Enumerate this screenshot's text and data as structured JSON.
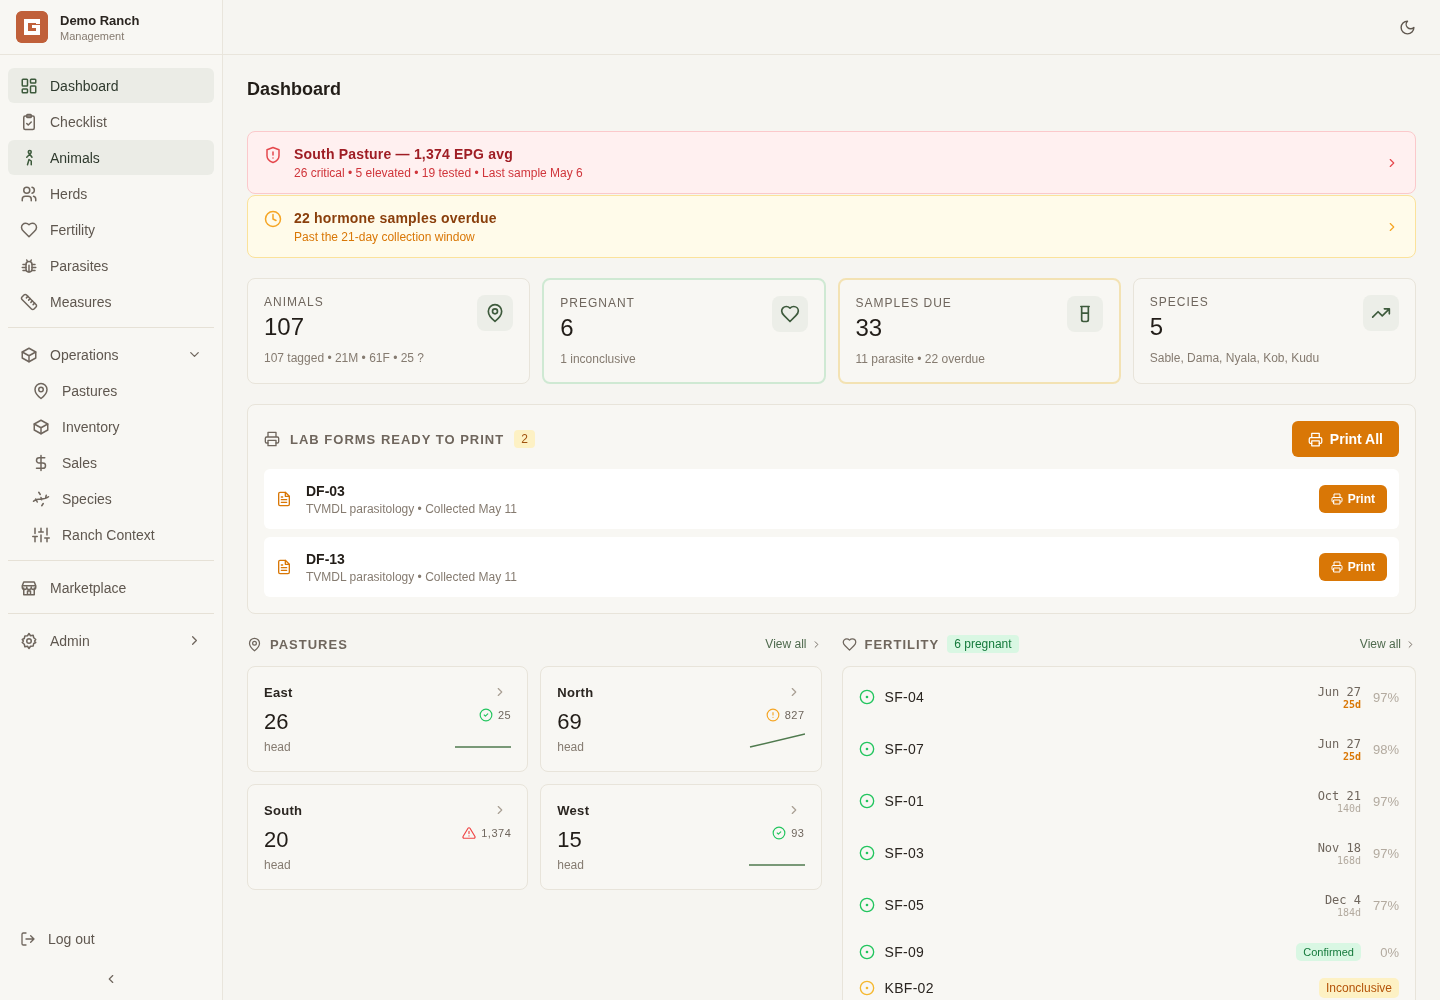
{
  "brand": {
    "name": "Demo Ranch",
    "subtitle": "Management"
  },
  "sidebar": {
    "items": [
      {
        "label": "Dashboard",
        "selected": true
      },
      {
        "label": "Checklist",
        "selected": false
      },
      {
        "label": "Animals",
        "selected": true
      },
      {
        "label": "Herds",
        "selected": false
      },
      {
        "label": "Fertility",
        "selected": false
      },
      {
        "label": "Parasites",
        "selected": false
      },
      {
        "label": "Measures",
        "selected": false
      }
    ],
    "groups": [
      {
        "label": "Operations",
        "expanded": true,
        "children": [
          {
            "label": "Pastures",
            "selected": false
          },
          {
            "label": "Inventory",
            "selected": false
          },
          {
            "label": "Sales",
            "selected": false
          },
          {
            "label": "Species",
            "selected": false
          },
          {
            "label": "Ranch Context",
            "selected": false
          }
        ]
      }
    ],
    "extra": [
      {
        "label": "Marketplace",
        "selected": false
      }
    ],
    "admin": {
      "label": "Admin",
      "expanded": false
    },
    "logout": "Log out"
  },
  "page_title": "Dashboard",
  "alerts": [
    {
      "kind": "critical",
      "title": "South Pasture — 1,374 EPG avg",
      "detail": "26 critical • 5 elevated • 19 tested • Last sample May 6"
    },
    {
      "kind": "warning",
      "title": "22 hormone samples overdue",
      "detail": "Past the 21-day collection window"
    }
  ],
  "stats": [
    {
      "label": "ANIMALS",
      "value": "107",
      "detail": "107 tagged • 21M • 61F • 25 ?",
      "kind": "neutral"
    },
    {
      "label": "PREGNANT",
      "value": "6",
      "detail": "1 inconclusive",
      "kind": "good"
    },
    {
      "label": "SAMPLES DUE",
      "value": "33",
      "detail": "11 parasite • 22 overdue",
      "kind": "warning"
    },
    {
      "label": "SPECIES",
      "value": "5",
      "detail": "Sable, Dama, Nyala, Kob, Kudu",
      "kind": "neutral"
    }
  ],
  "lab_forms": {
    "title": "LAB FORMS READY TO PRINT",
    "count": "2",
    "print_all": "Print All",
    "forms": [
      {
        "id": "DF-03",
        "detail": "TVMDL parasitology • Collected May 11",
        "action": "Print"
      },
      {
        "id": "DF-13",
        "detail": "TVMDL parasitology • Collected May 11",
        "action": "Print"
      }
    ]
  },
  "pastures": {
    "title": "PASTURES",
    "view_all": "View all",
    "items": [
      {
        "name": "East",
        "head": "26",
        "unit": "head",
        "kind": "ok",
        "reading": "25"
      },
      {
        "name": "North",
        "head": "69",
        "unit": "head",
        "kind": "warning",
        "reading": "827"
      },
      {
        "name": "South",
        "head": "20",
        "unit": "head",
        "kind": "critical",
        "reading": "1,374"
      },
      {
        "name": "West",
        "head": "15",
        "unit": "head",
        "kind": "ok",
        "reading": "93"
      }
    ]
  },
  "fertility": {
    "title": "FERTILITY",
    "badge": "6 pregnant",
    "view_all": "View all",
    "rows": [
      {
        "id": "SF-04",
        "color": "#22c55e",
        "kind": "dated",
        "date": "Jun 27",
        "days": "25d",
        "urgent": true,
        "confidence": "97%"
      },
      {
        "id": "SF-07",
        "color": "#22c55e",
        "kind": "dated",
        "date": "Jun 27",
        "days": "25d",
        "urgent": true,
        "confidence": "98%"
      },
      {
        "id": "SF-01",
        "color": "#22c55e",
        "kind": "dated",
        "date": "Oct 21",
        "days": "140d",
        "urgent": false,
        "confidence": "97%"
      },
      {
        "id": "SF-03",
        "color": "#22c55e",
        "kind": "dated",
        "date": "Nov 18",
        "days": "168d",
        "urgent": false,
        "confidence": "97%"
      },
      {
        "id": "SF-05",
        "color": "#22c55e",
        "kind": "dated",
        "date": "Dec 4",
        "days": "184d",
        "urgent": false,
        "confidence": "77%"
      },
      {
        "id": "SF-09",
        "color": "#22c55e",
        "kind": "confirmed",
        "tag": "Confirmed",
        "confidence": "0%"
      },
      {
        "id": "KBF-02",
        "color": "#f5b82e",
        "kind": "inconclusive",
        "tag": "Inconclusive"
      }
    ]
  }
}
